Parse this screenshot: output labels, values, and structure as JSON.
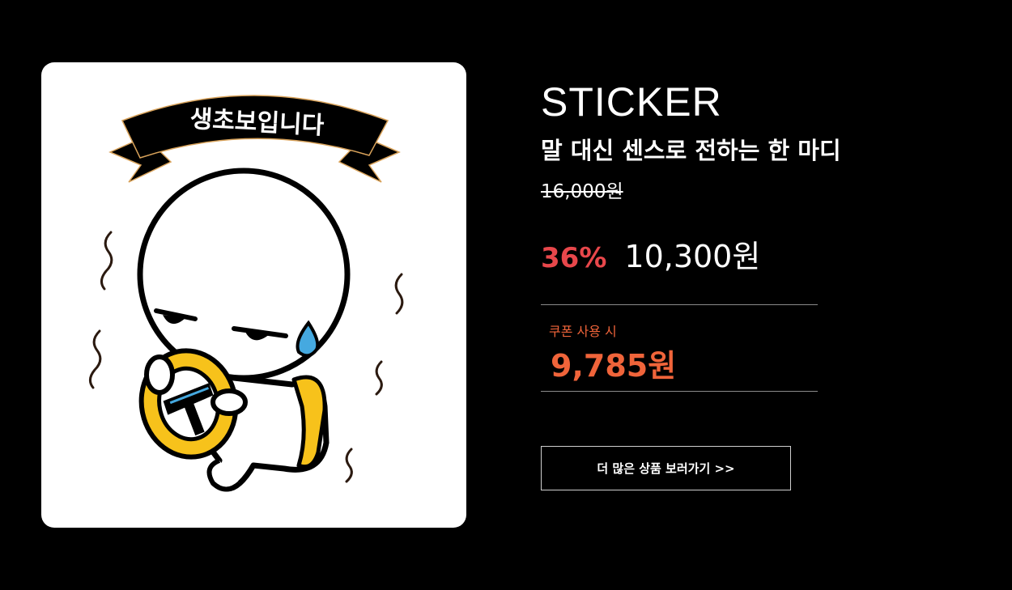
{
  "product": {
    "image": {
      "banner_text": "생초보입니다",
      "colors": {
        "background": "#ffffff",
        "outline": "#000000",
        "wheel": "#f7c21b",
        "sweat": "#45a9e0"
      }
    },
    "category": "STICKER",
    "headline": "말 대신 센스로 전하는 한 마디",
    "original_price": "16,000원",
    "discount_rate": "36%",
    "sale_price": "10,300원",
    "coupon": {
      "label": "쿠폰 사용 시",
      "price": "9,785원"
    },
    "more_button": "더 많은 상품 보러가기 >>"
  },
  "colors": {
    "discount": "#e8474b",
    "coupon": "#f0643a",
    "page_background": "#000000"
  }
}
